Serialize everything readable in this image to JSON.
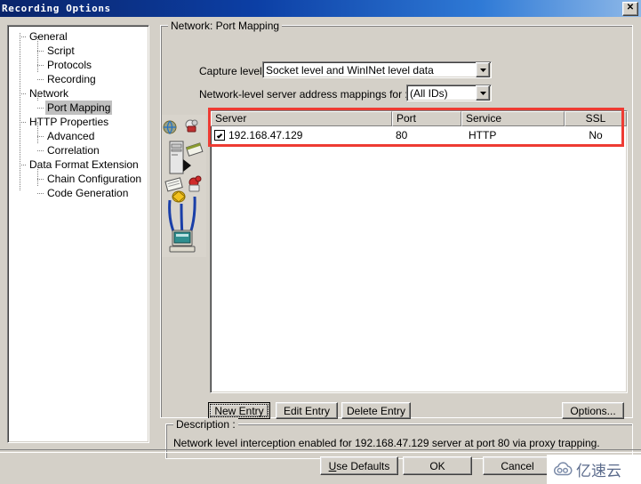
{
  "window": {
    "title": "Recording Options",
    "close_label": "✕"
  },
  "sidebar": {
    "items": [
      {
        "label": "General",
        "level": 1,
        "selected": false
      },
      {
        "label": "Script",
        "level": 2,
        "selected": false
      },
      {
        "label": "Protocols",
        "level": 2,
        "selected": false
      },
      {
        "label": "Recording",
        "level": 2,
        "selected": false
      },
      {
        "label": "Network",
        "level": 1,
        "selected": false
      },
      {
        "label": "Port Mapping",
        "level": 2,
        "selected": true
      },
      {
        "label": "HTTP Properties",
        "level": 1,
        "selected": false
      },
      {
        "label": "Advanced",
        "level": 2,
        "selected": false
      },
      {
        "label": "Correlation",
        "level": 2,
        "selected": false
      },
      {
        "label": "Data Format Extension",
        "level": 1,
        "selected": false
      },
      {
        "label": "Chain Configuration",
        "level": 2,
        "selected": false
      },
      {
        "label": "Code Generation",
        "level": 2,
        "selected": false
      }
    ]
  },
  "main": {
    "group_title": "Network: Port Mapping",
    "capture_level": {
      "label": "Capture level:",
      "value": "Socket level and WinINet level data"
    },
    "mappings_for": {
      "label": "Network-level server address mappings for :",
      "value": "(All IDs)"
    },
    "table": {
      "columns": [
        "Server",
        "Port",
        "Service",
        "SSL"
      ],
      "rows": [
        {
          "checked": true,
          "server": "192.168.47.129",
          "port": "80",
          "service": "HTTP",
          "ssl": "No"
        }
      ]
    },
    "buttons": {
      "new_entry": "New Entry",
      "edit_entry": "Edit Entry",
      "delete_entry": "Delete Entry",
      "options": "Options..."
    },
    "description": {
      "title": "Description :",
      "text": "Network level interception enabled for 192.168.47.129 server at port 80 via proxy trapping."
    }
  },
  "dialog_buttons": {
    "use_defaults_underline": "U",
    "use_defaults_rest": "se Defaults",
    "ok": "OK",
    "cancel": "Cancel"
  },
  "watermark": {
    "text": "亿速云"
  },
  "colors": {
    "titlebar_start": "#0a246a",
    "titlebar_end": "#8fb9e8",
    "face": "#d4d0c8",
    "highlight_red": "#ee3b33",
    "selection": "#c0c0c0"
  }
}
